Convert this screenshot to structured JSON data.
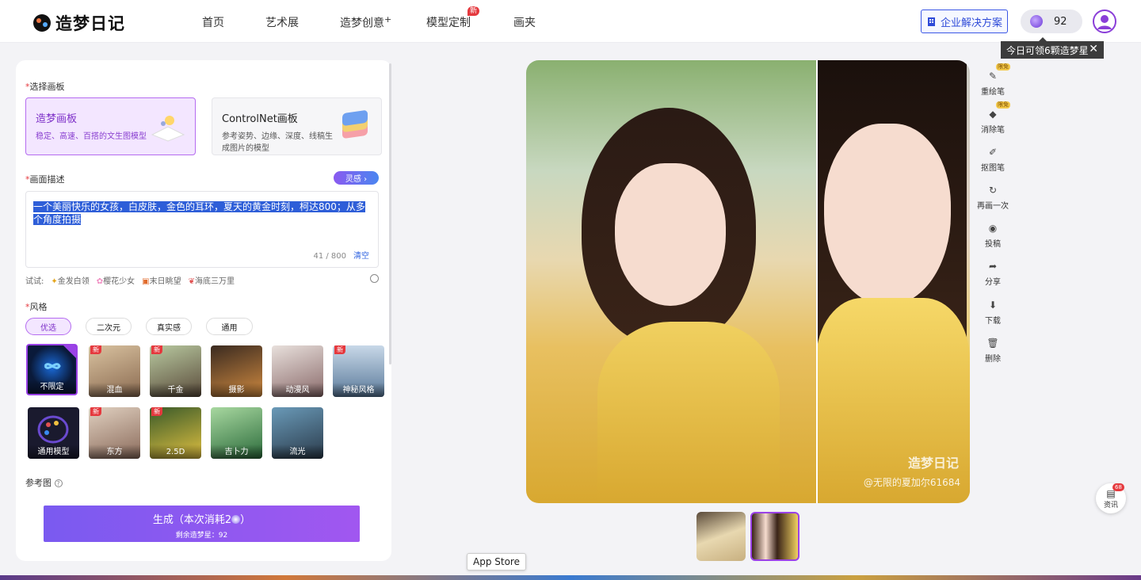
{
  "header": {
    "logo_text": "造梦日记",
    "nav": [
      {
        "label": "首页"
      },
      {
        "label": "艺术展"
      },
      {
        "label": "造梦创意",
        "sup": "+"
      },
      {
        "label": "模型定制",
        "badge": "新"
      },
      {
        "label": "画夹"
      }
    ],
    "enterprise_button": "企业解决方案",
    "coins": "92",
    "tooltip": "今日可领6颗造梦星"
  },
  "left": {
    "canvas_label": "选择画板",
    "canvas_cards": [
      {
        "title": "造梦画板",
        "desc": "稳定、高速、百搭的文生图模型"
      },
      {
        "title": "ControlNet画板",
        "desc": "参考姿势、边缘、深度、线稿生成图片的模型"
      }
    ],
    "prompt_label": "画面描述",
    "inspire_button": "灵感 ›",
    "prompt_text": "一个美丽快乐的女孩，白皮肤，金色的耳环，夏天的黄金时刻，柯达800；从多个角度拍摄",
    "char_count": "41 / 800",
    "clear": "清空",
    "try_label": "试试:",
    "try_items": [
      "金发白领",
      "樱花少女",
      "末日眺望",
      "海底三万里"
    ],
    "style_label": "风格",
    "style_tabs": [
      "优选",
      "二次元",
      "真实感",
      "通用"
    ],
    "styles": [
      {
        "name": "不限定",
        "new": false
      },
      {
        "name": "混血",
        "new": true
      },
      {
        "name": "千金",
        "new": true
      },
      {
        "name": "摄影",
        "new": false
      },
      {
        "name": "动漫风",
        "new": false
      },
      {
        "name": "神秘风格",
        "new": true
      },
      {
        "name": "通用模型",
        "new": false
      },
      {
        "name": "东方",
        "new": true
      },
      {
        "name": "2.5D",
        "new": true
      },
      {
        "name": "吉卜力",
        "new": false
      },
      {
        "name": "流光",
        "new": false
      }
    ],
    "ref_label": "参考图",
    "generate_button": "生成（本次消耗2",
    "generate_suffix": "）",
    "remaining": "剩余造梦星：92"
  },
  "canvas": {
    "watermark_logo": "造梦日记",
    "watermark_user": "@无限的夏加尔61684"
  },
  "tools": [
    {
      "label": "重绘笔",
      "icon": "brush-icon",
      "hot": "限免"
    },
    {
      "label": "消除笔",
      "icon": "eraser-icon",
      "hot": "限免"
    },
    {
      "label": "抠图笔",
      "icon": "cutout-pen-icon",
      "hot": ""
    },
    {
      "label": "再画一次",
      "icon": "redo-icon",
      "hot": ""
    },
    {
      "label": "投稿",
      "icon": "eye-icon",
      "hot": ""
    },
    {
      "label": "分享",
      "icon": "share-icon",
      "hot": ""
    },
    {
      "label": "下载",
      "icon": "download-icon",
      "hot": ""
    },
    {
      "label": "删除",
      "icon": "trash-icon",
      "hot": ""
    }
  ],
  "news": {
    "label": "资讯",
    "badge": "68"
  },
  "dock_tooltip": "App Store"
}
